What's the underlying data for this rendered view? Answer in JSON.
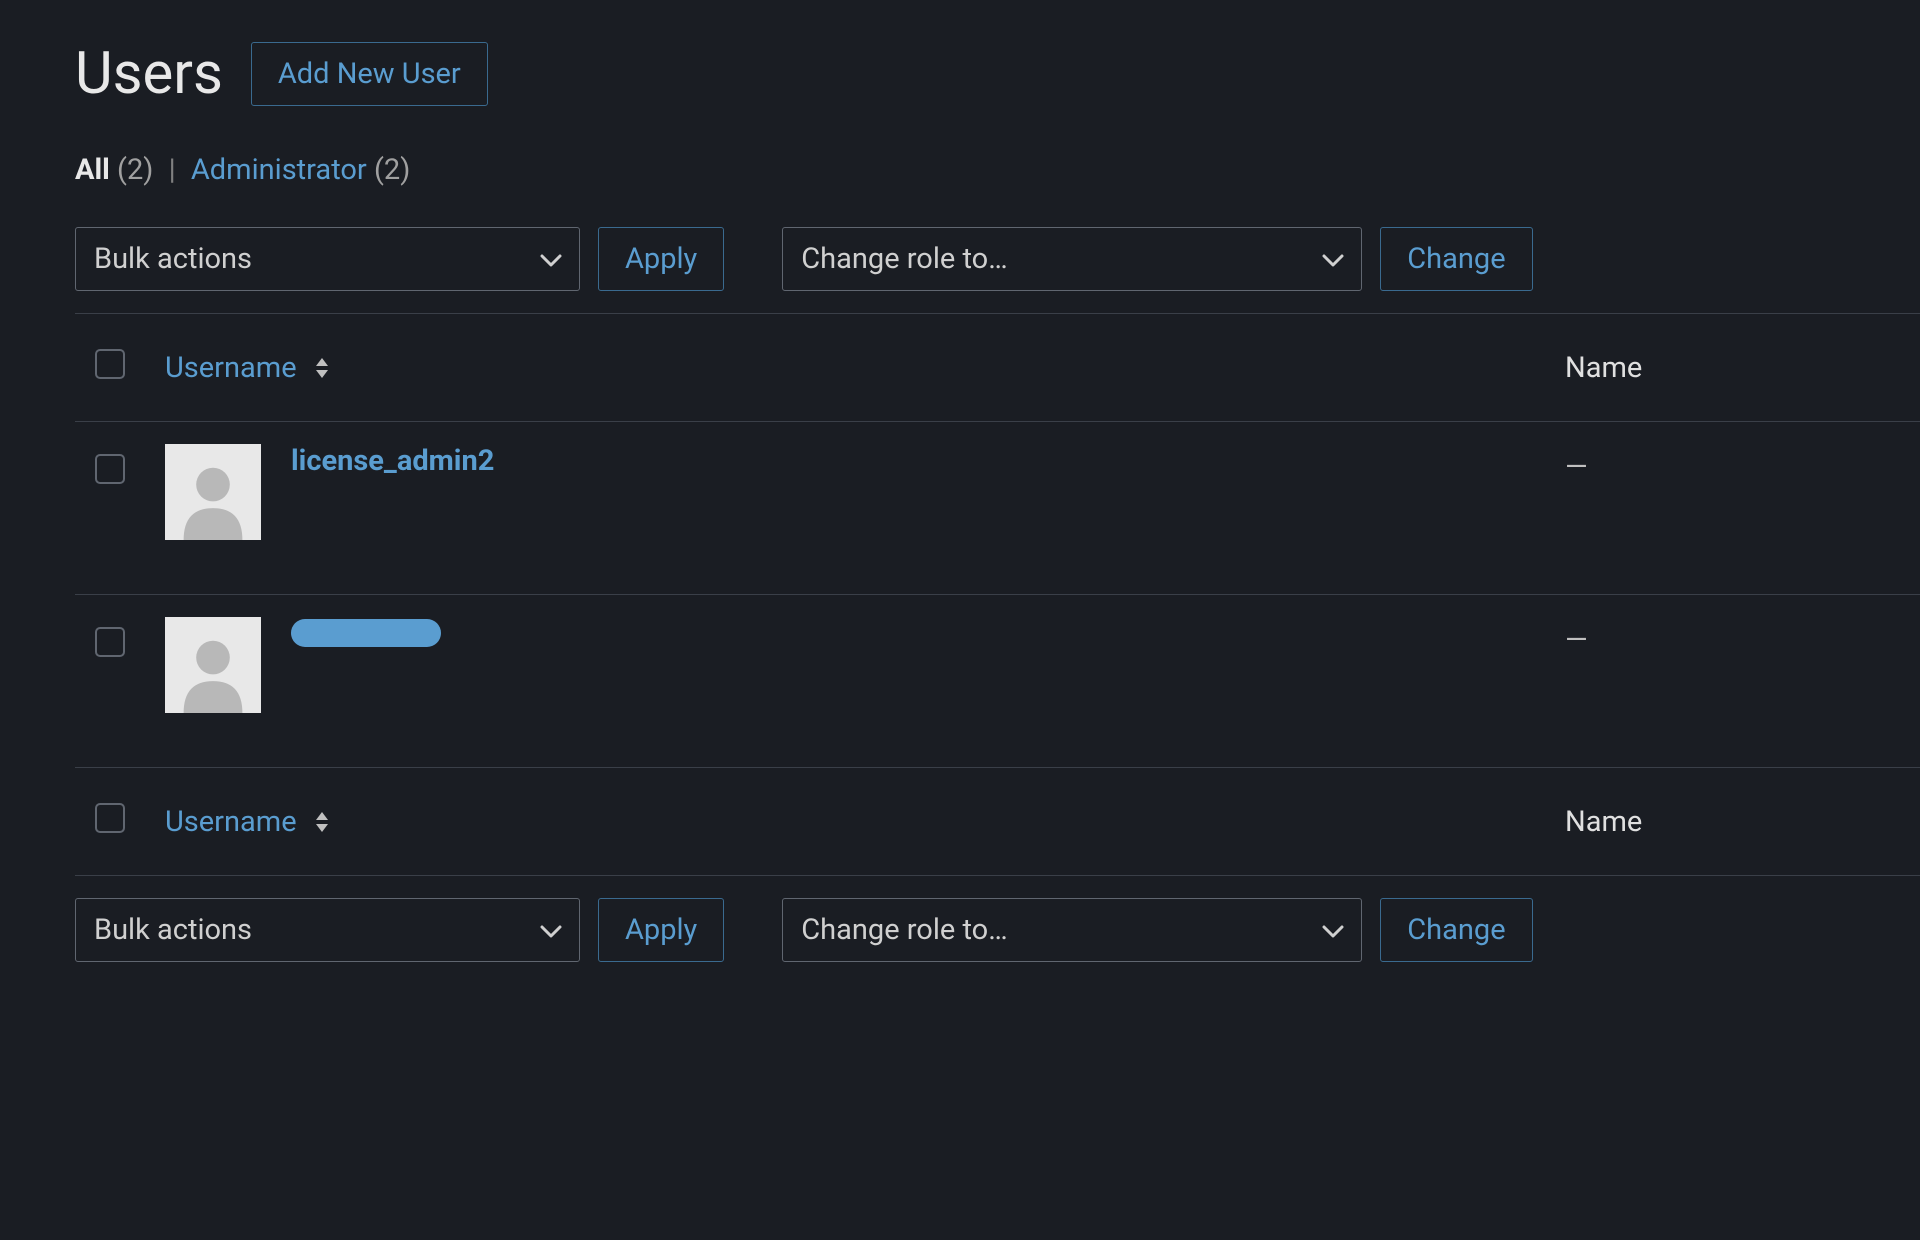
{
  "page": {
    "title": "Users",
    "add_button": "Add New User"
  },
  "filters": {
    "all_label": "All",
    "all_count": "(2)",
    "admin_label": "Administrator",
    "admin_count": "(2)"
  },
  "controls": {
    "bulk_actions_label": "Bulk actions",
    "apply_label": "Apply",
    "change_role_label": "Change role to…",
    "change_label": "Change"
  },
  "columns": {
    "username": "Username",
    "name": "Name"
  },
  "users": [
    {
      "username": "license_admin2",
      "name": "—",
      "redacted": false
    },
    {
      "username": "",
      "name": "—",
      "redacted": true
    }
  ]
}
